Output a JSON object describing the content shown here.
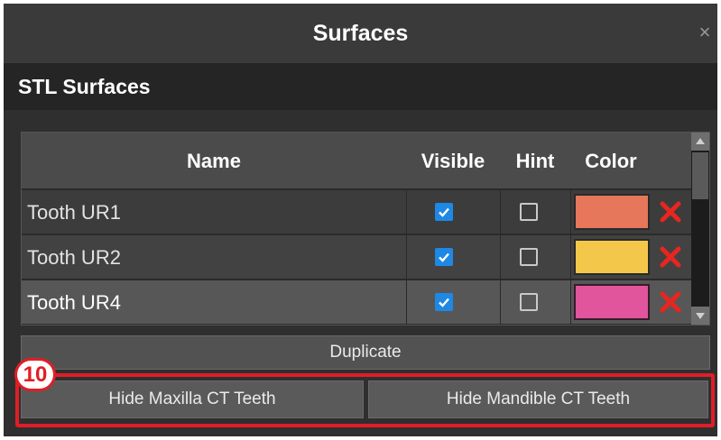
{
  "window": {
    "title": "Surfaces",
    "close_glyph": "×"
  },
  "section": {
    "title": "STL Surfaces"
  },
  "table": {
    "columns": [
      "Name",
      "Visible",
      "Hint",
      "Color"
    ],
    "rows": [
      {
        "name": "Tooth UR1",
        "visible": true,
        "hint": false,
        "color": "#e7775a",
        "selected": false
      },
      {
        "name": "Tooth UR2",
        "visible": true,
        "hint": false,
        "color": "#f3c84a",
        "selected": false
      },
      {
        "name": "Tooth UR4",
        "visible": true,
        "hint": false,
        "color": "#e0559c",
        "selected": true
      }
    ]
  },
  "buttons": {
    "duplicate": "Duplicate",
    "hide_maxilla": "Hide Maxilla CT Teeth",
    "hide_mandible": "Hide Mandible CT Teeth"
  },
  "callout": {
    "label": "10"
  },
  "colors": {
    "accent": "#e01e26",
    "checkbox": "#1e88e5",
    "delete": "#e8251f"
  },
  "icons": [
    "close-icon",
    "checkbox-checked-icon",
    "checkbox-empty-icon",
    "delete-x-icon",
    "scroll-up-arrow-icon",
    "scroll-down-arrow-icon"
  ]
}
